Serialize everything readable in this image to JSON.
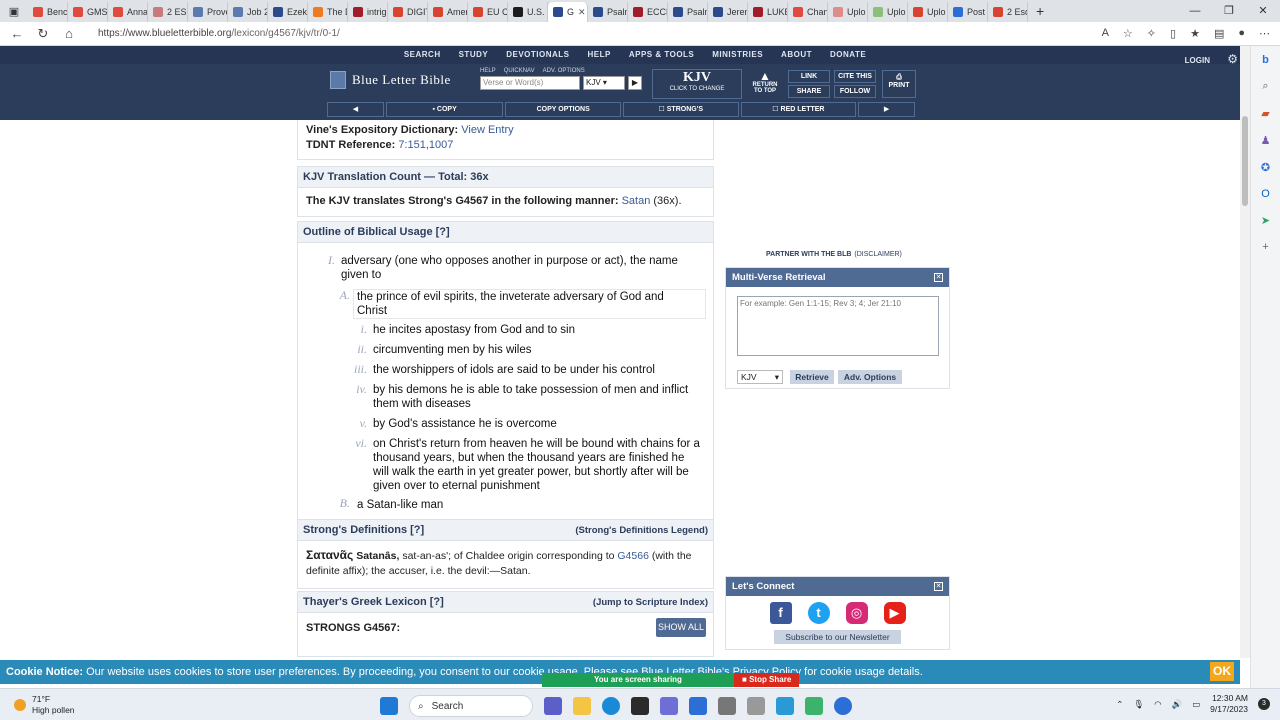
{
  "browser": {
    "tabs": [
      {
        "title": "Benc",
        "color": "#e04a3f"
      },
      {
        "title": "GMS",
        "color": "#e04a3f"
      },
      {
        "title": "Anna",
        "color": "#e04a3f"
      },
      {
        "title": "2 ESC",
        "color": "#c97b7b"
      },
      {
        "title": "Prove",
        "color": "#5a7ab0"
      },
      {
        "title": "Job 2",
        "color": "#5a7ab0"
      },
      {
        "title": "Ezeki",
        "color": "#2b4b8c"
      },
      {
        "title": "The D",
        "color": "#f07a22"
      },
      {
        "title": "intrig",
        "color": "#a11d2a"
      },
      {
        "title": "DIGIT",
        "color": "#d8442f"
      },
      {
        "title": "Amer",
        "color": "#d8442f"
      },
      {
        "title": "EU Cl",
        "color": "#d8442f"
      },
      {
        "title": "U.S. S",
        "color": "#1c1c1c"
      },
      {
        "title": "G",
        "color": "#2b4b8c",
        "active": true
      },
      {
        "title": "Psalm",
        "color": "#2b4b8c"
      },
      {
        "title": "ECCL",
        "color": "#a11d2a"
      },
      {
        "title": "Psalm",
        "color": "#2b4b8c"
      },
      {
        "title": "Jerem",
        "color": "#2b4b8c"
      },
      {
        "title": "LUKE",
        "color": "#a11d2a"
      },
      {
        "title": "Chan",
        "color": "#e04a3f"
      },
      {
        "title": "Uplo",
        "color": "#e08a8a"
      },
      {
        "title": "Uplo",
        "color": "#8ac07a"
      },
      {
        "title": "Uplo",
        "color": "#d8442f"
      },
      {
        "title": "Post",
        "color": "#2b6fd6"
      },
      {
        "title": "2 Esd",
        "color": "#d8442f"
      }
    ],
    "url_host": "https://www.blueletterbible.org",
    "url_path": "/lexicon/g4567/kjv/tr/0-1/"
  },
  "blb": {
    "topnav": [
      "SEARCH",
      "STUDY",
      "DEVOTIONALS",
      "HELP",
      "APPS & TOOLS",
      "MINISTRIES",
      "ABOUT",
      "DONATE"
    ],
    "login": "LOGIN",
    "logo": "Blue Letter Bible",
    "mini_links": [
      "HELP",
      "QUICKNAV",
      "ADV. OPTIONS"
    ],
    "verse_placeholder": "Verse or Word(s)",
    "version": "KJV",
    "kjv_big": "KJV",
    "kjv_small": "CLICK TO CHANGE",
    "return_top": "RETURN TO TOP",
    "link": "LINK",
    "cite": "CITE THIS",
    "share": "SHARE",
    "follow": "FOLLOW",
    "print": "PRINT",
    "toolbar": [
      "◀",
      "COPY",
      "COPY OPTIONS",
      "STRONG'S",
      "RED LETTER",
      "▶"
    ]
  },
  "entry": {
    "vines_label": "Vine's Expository Dictionary:",
    "vines_link": "View Entry",
    "tdnt_label": "TDNT Reference:",
    "tdnt_link": "7:151,1007",
    "count_header": "KJV Translation Count — Total: 36x",
    "count_text_bold": "The KJV translates Strong's G4567 in the following manner:",
    "count_word": "Satan",
    "count_num": "(36x).",
    "outline_header": "Outline of Biblical Usage [?]",
    "outline": {
      "I_num": "I.",
      "I_text": "adversary (one who opposes another in purpose or act), the name given to",
      "A_num": "A.",
      "A_text": "the prince of evil spirits, the inveterate adversary of God and Christ",
      "items": [
        {
          "num": "i.",
          "text": "he incites apostasy from God and to sin"
        },
        {
          "num": "ii.",
          "text": "circumventing men by his wiles"
        },
        {
          "num": "iii.",
          "text": "the worshippers of idols are said to be under his control"
        },
        {
          "num": "iv.",
          "text": "by his demons he is able to take possession of men and inflict them with diseases"
        },
        {
          "num": "v.",
          "text": "by God's assistance he is overcome"
        },
        {
          "num": "vi.",
          "text": "on Christ's return from heaven he will be bound with chains for a thousand years, but when the thousand years are finished he will walk the earth in yet greater power, but shortly after will be given over to eternal punishment"
        }
      ],
      "B_num": "B.",
      "B_text": "a Satan-like man"
    },
    "strongs_header": "Strong's Definitions [?]",
    "strongs_legend": "(Strong's Definitions Legend)",
    "strongs_greek": "Σατανᾶς",
    "strongs_translit": "Satanâs,",
    "strongs_def1": "sat-an-as'; of Chaldee origin corresponding to",
    "strongs_link": "G4566",
    "strongs_def2": "(with the definite affix); the accuser, i.e. the devil:—Satan.",
    "thayer_header": "Thayer's Greek Lexicon [?]",
    "thayer_jump": "(Jump to Scripture Index)",
    "thayer_strongs": "STRONGS G4567:",
    "show_all": "SHOW ALL"
  },
  "sidebar": {
    "partner": "PARTNER WITH THE BLB",
    "disclaimer": "(DISCLAIMER)",
    "mvr_title": "Multi-Verse Retrieval",
    "mvr_placeholder": "For example: Gen 1:1-15; Rev 3; 4; Jer 21:10",
    "mvr_version": "KJV",
    "retrieve": "Retrieve",
    "adv_options": "Adv. Options",
    "connect_title": "Let's Connect",
    "newsletter": "Subscribe to our Newsletter"
  },
  "cookie": {
    "label": "Cookie Notice:",
    "text": "Our website uses cookies to store user preferences. By proceeding, you consent to our cookie usage. Please see Blue Letter Bible's Privacy Policy for cookie usage details.",
    "ok": "OK"
  },
  "screen_share": {
    "text": "You are screen sharing",
    "stop": "Stop Share"
  },
  "taskbar": {
    "temp": "71°F",
    "pollen": "High pollen",
    "search": "Search",
    "time": "12:30 AM",
    "date": "9/17/2023",
    "badge": "3"
  }
}
